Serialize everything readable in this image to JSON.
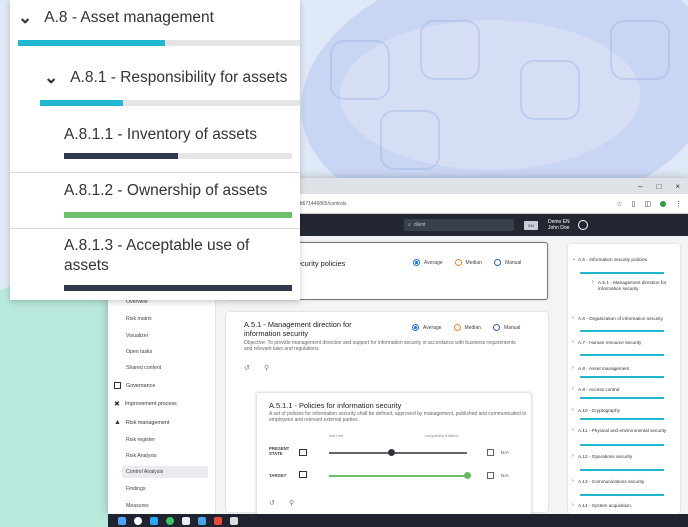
{
  "browser": {
    "url": "…2b671446865/controls",
    "min_icon": "–",
    "max_icon": "□",
    "close_icon": "×"
  },
  "app": {
    "search_value": "client",
    "lang": "EN",
    "user_line1": "Demo EN",
    "user_line2": "John Doe"
  },
  "sidebar": {
    "overview": "Overview",
    "risk_matrix": "Risk matrix",
    "visualizer": "Visualizer",
    "open_tasks": "Open tasks",
    "shared_content": "Shared content",
    "governance": "Governance",
    "improvement": "Improvement process",
    "risk_management": "Risk management",
    "risk_register": "Risk register",
    "risk_analysis": "Risk Analysis",
    "control_analysis": "Control Analysis",
    "findings": "Findings",
    "measures": "Measures"
  },
  "main": {
    "card1_title": "n security policies",
    "card2_title": "A.5.1 - Management direction for information security",
    "card2_objective": "Objective: To provide management direction and support for information security in accordance with business requirements and relevant laws and regulations.",
    "card3_title": "A.5.1.1 - Policies for information security",
    "card3_desc": "A set of policies for information security shall be defined, approved by management, published and communicated to employees and relevant external parties.",
    "radio_average": "Average",
    "radio_median": "Median",
    "radio_manual": "Manual",
    "hint_low": "Not met",
    "hint_high": "completely fulfilled",
    "present_state": "PRESENT STATE",
    "target": "TARGET",
    "na": "N/A",
    "present_value": 0.45,
    "target_value": 1.0
  },
  "right_panel": {
    "items": [
      "A.5 - Information security policies",
      "A.5.1 - Management direction for information security",
      "A.6 - Organization of information security",
      "A.7 - Human resource security",
      "A.8 - Asset management",
      "A.9 - Access control",
      "A.10 - Cryptography",
      "A.11 - Physical and environmental security",
      "A.12 - Operations security",
      "A.13 - Communications security",
      "A.14 - System acquisition,"
    ]
  },
  "zoom": {
    "l1": "A.8 - Asset management",
    "l2": "A.8.1 - Responsibility for assets",
    "l3a": "A.8.1.1 - Inventory of assets",
    "l3b": "A.8.1.2 - Ownership of assets",
    "l3c": "A.8.1.3 - Acceptable use of assets",
    "progress_inventory": 0.5,
    "progress_ownership": 1.0,
    "progress_acceptable": 1.0
  },
  "colors": {
    "accent_cyan": "#20b8d0",
    "progress_dark": "#2e3a4c",
    "progress_green": "#6cbf6c",
    "radio_blue": "#1a73e8",
    "radio_orange": "#ee8a2a"
  }
}
